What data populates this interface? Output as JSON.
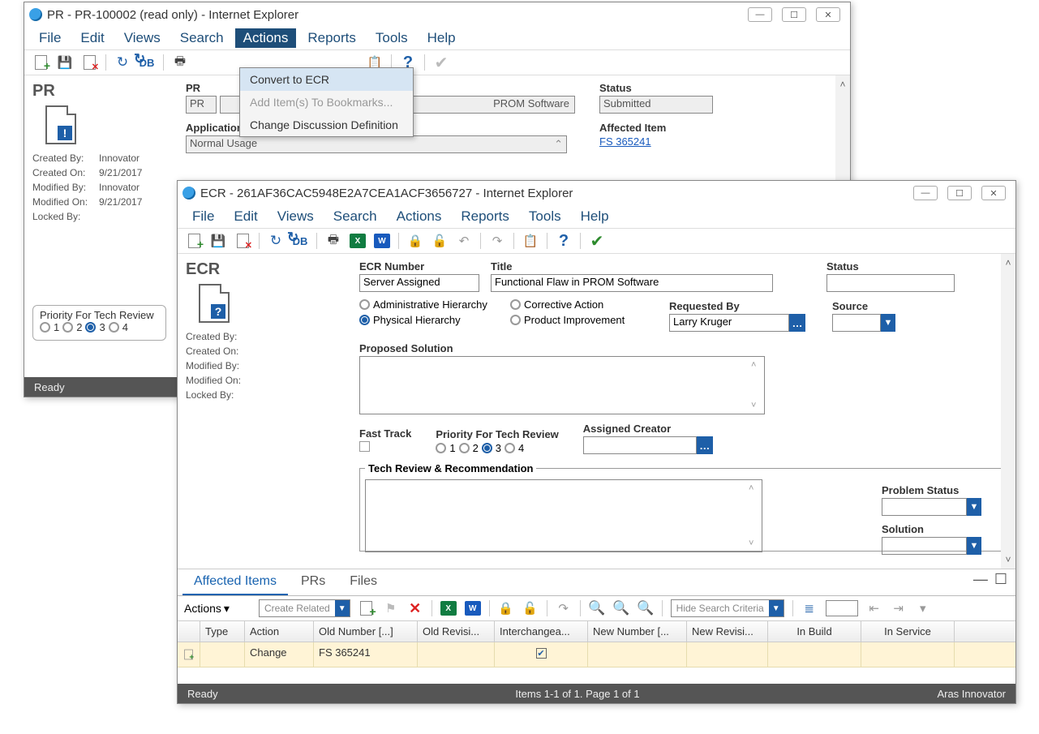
{
  "pr_window": {
    "title": "PR - PR-100002 (read only) - Internet Explorer",
    "menu": [
      "File",
      "Edit",
      "Views",
      "Search",
      "Actions",
      "Reports",
      "Tools",
      "Help"
    ],
    "active_menu": "Actions",
    "dropdown": {
      "items": [
        "Convert to ECR",
        "Add Item(s) To Bookmarks...",
        "Change Discussion Definition"
      ],
      "highlight_index": 0
    },
    "heading": "PR",
    "meta": {
      "created_by_k": "Created By:",
      "created_by_v": "Innovator",
      "created_on_k": "Created On:",
      "created_on_v": "9/21/2017",
      "modified_by_k": "Modified By:",
      "modified_by_v": "Innovator",
      "modified_on_k": "Modified On:",
      "modified_on_v": "9/21/2017",
      "locked_by_k": "Locked By:",
      "locked_by_v": ""
    },
    "form": {
      "pr_num_label": "PR",
      "pr_num_value": "PR",
      "title_suffix": "PROM Software",
      "app_env_label": "Application Environment",
      "app_env_value": "Normal Usage",
      "status_label": "Status",
      "status_value": "Submitted",
      "affected_label": "Affected Item",
      "affected_link": "FS 365241"
    },
    "priority_label": "Priority For Tech Review",
    "priority_options": [
      "1",
      "2",
      "3",
      "4"
    ],
    "priority_selected": "3",
    "status_ready": "Ready"
  },
  "ecr_window": {
    "title": "ECR - 261AF36CAC5948E2A7CEA1ACF3656727 - Internet Explorer",
    "menu": [
      "File",
      "Edit",
      "Views",
      "Search",
      "Actions",
      "Reports",
      "Tools",
      "Help"
    ],
    "heading": "ECR",
    "meta": {
      "created_by_k": "Created By:",
      "created_on_k": "Created On:",
      "modified_by_k": "Modified By:",
      "modified_on_k": "Modified On:",
      "locked_by_k": "Locked By:"
    },
    "form": {
      "ecr_num_label": "ECR Number",
      "ecr_num_value": "Server Assigned",
      "title_label": "Title",
      "title_value": "Functional Flaw in PROM Software",
      "status_label": "Status",
      "source_label": "Source",
      "radio_admin": "Administrative Hierarchy",
      "radio_phys": "Physical Hierarchy",
      "radio_corr": "Corrective Action",
      "radio_prod": "Product Improvement",
      "req_by_label": "Requested By",
      "req_by_value": "Larry Kruger",
      "proposed_label": "Proposed Solution",
      "fast_track_label": "Fast Track",
      "priority_label": "Priority For Tech Review",
      "priority_options": [
        "1",
        "2",
        "3",
        "4"
      ],
      "priority_selected": "3",
      "assigned_label": "Assigned Creator",
      "techrec_label": "Tech Review & Recommendation",
      "problem_status_label": "Problem Status",
      "solution_label": "Solution"
    },
    "tabs": {
      "items": [
        "Affected Items",
        "PRs",
        "Files"
      ],
      "active": 0
    },
    "grid_toolbar": {
      "actions_label": "Actions",
      "create_related": "Create Related",
      "hide_search": "Hide Search Criteria"
    },
    "grid": {
      "columns": [
        "",
        "Type",
        "Action",
        "Old Number [...]",
        "Old Revisi...",
        "Interchangea...",
        "New Number [...",
        "New Revisi...",
        "In Build",
        "In Service"
      ],
      "row": {
        "type": "",
        "action": "Change",
        "old_num": "FS 365241",
        "old_rev": "",
        "inter_checked": true,
        "new_num": "",
        "new_rev": "",
        "in_build": "",
        "in_service": ""
      }
    },
    "statusbar": {
      "ready": "Ready",
      "paging": "Items 1-1 of 1. Page 1 of 1",
      "brand": "Aras Innovator"
    }
  }
}
